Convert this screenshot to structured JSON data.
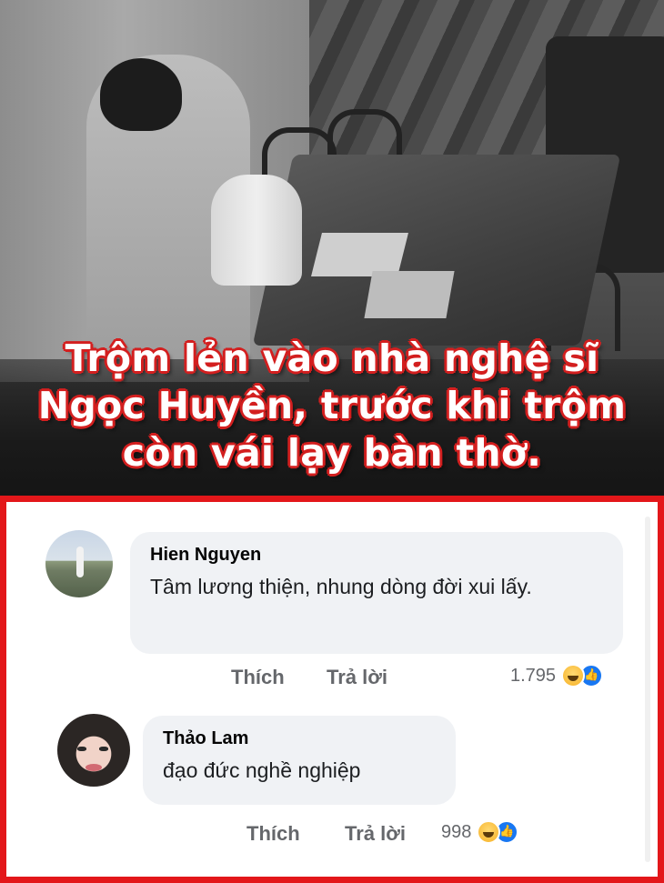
{
  "headline": {
    "line1": "Trộm lẻn vào nhà nghệ sĩ",
    "line2": "Ngọc Huyền, trước khi trộm",
    "line3": "còn vái lạy bàn thờ."
  },
  "colors": {
    "border_red": "#e3171a",
    "bubble_bg": "#f0f2f5",
    "action_gray": "#65676b",
    "like_blue": "#1877f2"
  },
  "comments": [
    {
      "name": "Hien Nguyen",
      "text": "Tâm lương thiện, nhung dòng đời xui lấy.",
      "like_action": "Thích",
      "reply_action": "Trả lời",
      "reaction_count": "1.795",
      "reaction_icons": [
        "haha-icon",
        "like-icon"
      ]
    },
    {
      "name": "Thảo Lam",
      "text": "đạo đức nghề nghiệp",
      "like_action": "Thích",
      "reply_action": "Trả lời",
      "reaction_count": "998",
      "reaction_icons": [
        "haha-icon",
        "like-icon"
      ]
    }
  ]
}
